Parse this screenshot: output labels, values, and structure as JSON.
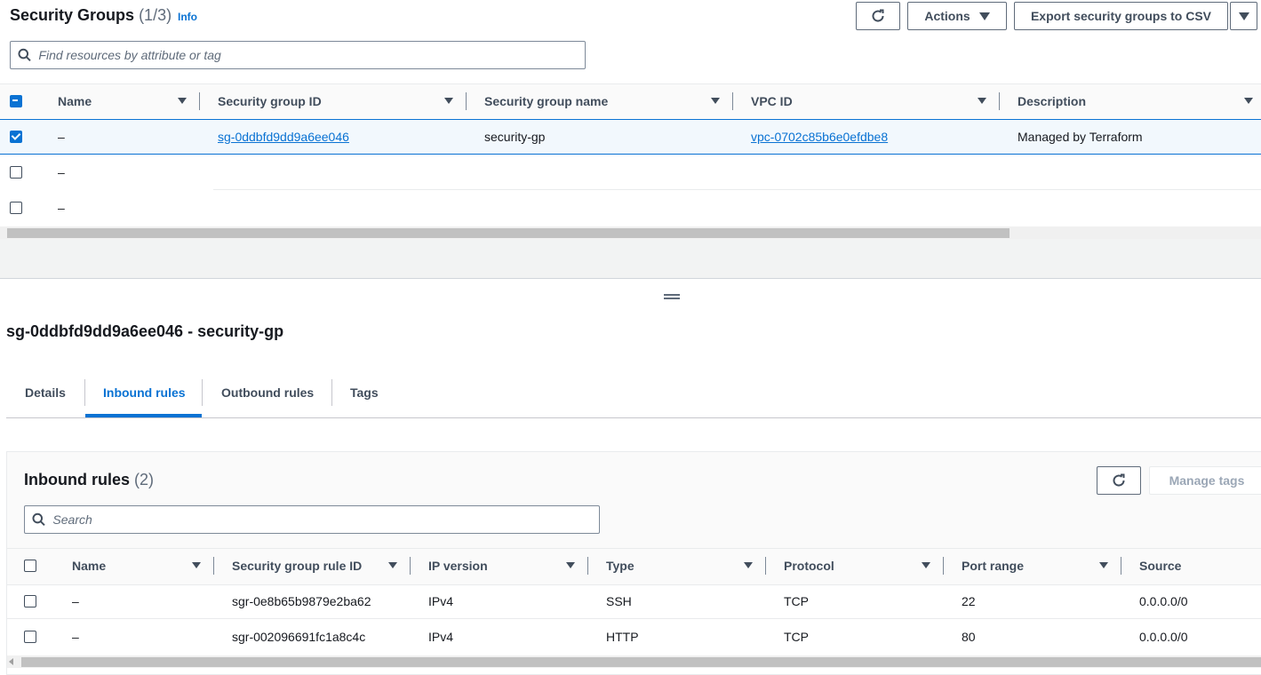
{
  "header": {
    "title": "Security Groups",
    "count": "(1/3)",
    "info": "Info",
    "actions_label": "Actions",
    "export_label": "Export security groups to CSV"
  },
  "search": {
    "placeholder": "Find resources by attribute or tag"
  },
  "table": {
    "columns": [
      "Name",
      "Security group ID",
      "Security group name",
      "VPC ID",
      "Description"
    ],
    "rows": [
      {
        "selected": true,
        "name": "–",
        "sg_id": "sg-0ddbfd9dd9a6ee046",
        "sg_name": "security-gp",
        "vpc_id": "vpc-0702c85b6e0efdbe8",
        "description": "Managed by Terraform"
      },
      {
        "selected": false,
        "name": "–"
      },
      {
        "selected": false,
        "name": "–"
      }
    ]
  },
  "detail": {
    "title": "sg-0ddbfd9dd9a6ee046 - security-gp",
    "tabs": [
      "Details",
      "Inbound rules",
      "Outbound rules",
      "Tags"
    ],
    "active_tab": "Inbound rules"
  },
  "inbound": {
    "title": "Inbound rules",
    "count": "(2)",
    "manage_tags_label": "Manage tags",
    "search_placeholder": "Search",
    "columns": [
      "Name",
      "Security group rule ID",
      "IP version",
      "Type",
      "Protocol",
      "Port range",
      "Source"
    ],
    "rows": [
      {
        "name": "–",
        "rule_id": "sgr-0e8b65b9879e2ba62",
        "ip_version": "IPv4",
        "type": "SSH",
        "protocol": "TCP",
        "port_range": "22",
        "source": "0.0.0.0/0"
      },
      {
        "name": "–",
        "rule_id": "sgr-002096691fc1a8c4c",
        "ip_version": "IPv4",
        "type": "HTTP",
        "protocol": "TCP",
        "port_range": "80",
        "source": "0.0.0.0/0"
      }
    ]
  },
  "colors": {
    "accent": "#0972d3",
    "selected_row_bg": "#f2f8fd",
    "text": "#16191f"
  },
  "icons": [
    "refresh-icon",
    "caret-down-icon",
    "search-icon",
    "sort-icon",
    "drag-handle-icon"
  ]
}
